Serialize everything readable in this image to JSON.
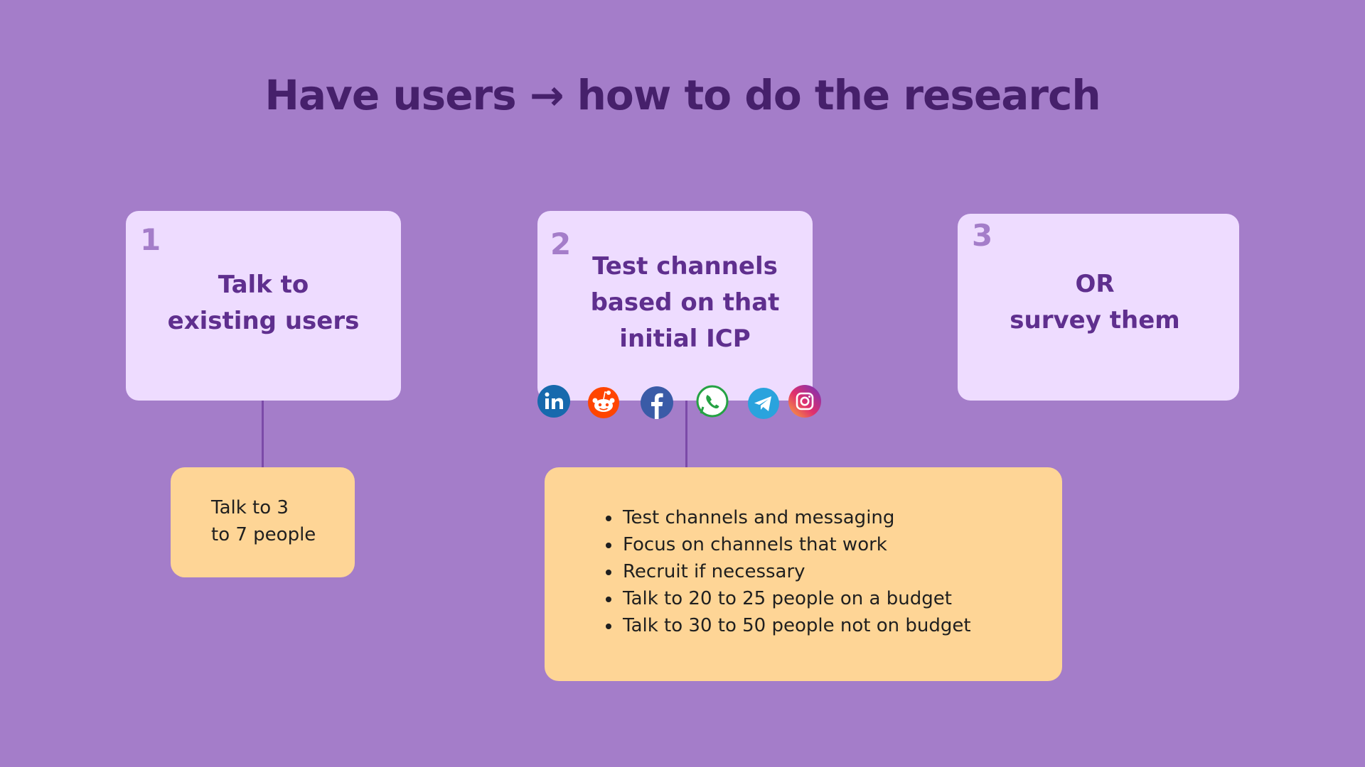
{
  "title": "Have users → how to do the research",
  "steps": [
    {
      "number": "1",
      "lines": [
        "Talk to",
        "existing users"
      ]
    },
    {
      "number": "2",
      "lines": [
        "Test channels",
        "based on that",
        "initial ICP"
      ]
    },
    {
      "number": "3",
      "lines": [
        "OR",
        "survey them"
      ]
    }
  ],
  "note1": {
    "lines": [
      "Talk to 3",
      "to 7 people"
    ]
  },
  "note2": {
    "items": [
      "Test channels and messaging",
      "Focus on channels that work",
      "Recruit if necessary",
      "Talk to 20 to 25 people on a budget",
      "Talk to 30 to 50 people not on budget"
    ]
  },
  "channel_icons": [
    "linkedin-icon",
    "reddit-icon",
    "facebook-icon",
    "whatsapp-icon",
    "telegram-icon",
    "instagram-icon"
  ],
  "colors": {
    "background": "#a47dc9",
    "title": "#46206b",
    "step_box": "#eedcff",
    "step_text": "#5f2f8e",
    "note_box": "#fed596",
    "connector": "#7b4aa8"
  }
}
